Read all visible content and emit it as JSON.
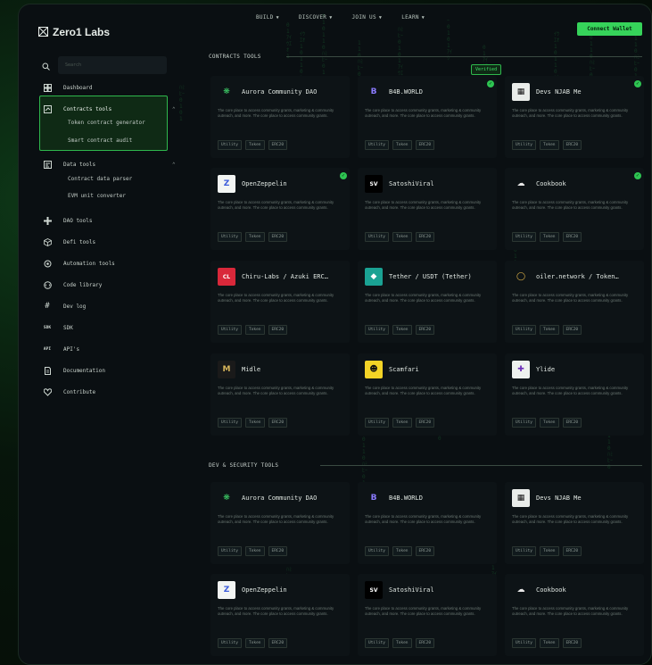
{
  "header": {
    "logo_text": "Zero1 Labs",
    "nav": [
      {
        "label": "BUILD"
      },
      {
        "label": "DISCOVER"
      },
      {
        "label": "JOIN US"
      },
      {
        "label": "LEARN"
      }
    ],
    "connect_label": "Connect Wallet"
  },
  "sidebar": {
    "search_placeholder": "Search",
    "items": [
      {
        "label": "Dashboard",
        "icon": "dashboard-icon"
      },
      {
        "label": "Contracts tools",
        "icon": "contract-icon",
        "expanded": true,
        "children": [
          "Token contract generator",
          "Smart contract audit"
        ]
      },
      {
        "label": "Data tools",
        "icon": "data-icon",
        "expanded": true,
        "children": [
          "Contract data parser",
          "EVM unit converter"
        ]
      },
      {
        "label": "DAO tools",
        "icon": "dao-icon"
      },
      {
        "label": "Defi tools",
        "icon": "cube-icon"
      },
      {
        "label": "Automation tools",
        "icon": "automation-icon"
      },
      {
        "label": "Code library",
        "icon": "code-icon"
      },
      {
        "label": "Dev log",
        "icon": "hash-icon"
      },
      {
        "label": "SDK",
        "icon": "sdk-icon",
        "icon_text": "SDK"
      },
      {
        "label": "API's",
        "icon": "api-icon",
        "icon_text": "API"
      },
      {
        "label": "Documentation",
        "icon": "document-icon"
      },
      {
        "label": "Contribute",
        "icon": "heart-icon"
      }
    ]
  },
  "sections": [
    {
      "title": "CONTRACTS TOOLS",
      "cards": [
        {
          "name": "Aurora Community DAO",
          "logo": "aurora",
          "verified": false
        },
        {
          "name": "B4B.WORLD",
          "logo": "b4b",
          "verified": true
        },
        {
          "name": "Devs NJAB Me",
          "logo": "devs",
          "verified": true
        },
        {
          "name": "OpenZeppelin",
          "logo": "oz",
          "verified": true
        },
        {
          "name": "SatoshiViral",
          "logo": "satoshi",
          "verified": false
        },
        {
          "name": "Cookbook",
          "logo": "cookbook",
          "verified": true
        },
        {
          "name": "Chiru-Labs / Azuki ERC…",
          "logo": "chiru",
          "verified": false
        },
        {
          "name": "Tether / USDT (Tether)",
          "logo": "tether",
          "verified": false
        },
        {
          "name": "oiler.network / Token…",
          "logo": "oiler",
          "verified": false
        },
        {
          "name": "Midle",
          "logo": "midle",
          "verified": false
        },
        {
          "name": "Scamfari",
          "logo": "scamfari",
          "verified": false
        },
        {
          "name": "Ylide",
          "logo": "ylide",
          "verified": false
        }
      ]
    },
    {
      "title": "DEV & SECURITY TOOLS",
      "cards": [
        {
          "name": "Aurora Community DAO",
          "logo": "aurora",
          "verified": false
        },
        {
          "name": "B4B.WORLD",
          "logo": "b4b",
          "verified": false
        },
        {
          "name": "Devs NJAB Me",
          "logo": "devs",
          "verified": false
        },
        {
          "name": "OpenZeppelin",
          "logo": "oz",
          "verified": false
        },
        {
          "name": "SatoshiViral",
          "logo": "satoshi",
          "verified": false
        },
        {
          "name": "Cookbook",
          "logo": "cookbook",
          "verified": false
        }
      ]
    }
  ],
  "card_description": "The core place to access community grants, marketing & community outreach, and more. The core place to access community grants.",
  "card_tags": [
    "Utility",
    "Token",
    "ERC20"
  ],
  "tooltip": "Verified",
  "colors": {
    "accent": "#36d35a",
    "background": "#0a0f12",
    "card": "#0d1316"
  }
}
